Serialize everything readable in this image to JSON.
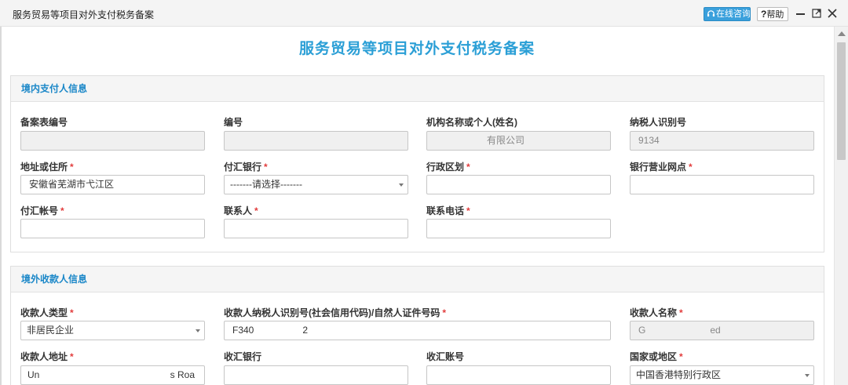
{
  "window": {
    "title": "服务贸易等项目对外支付税务备案",
    "consult_label": "在线咨询",
    "help_label": "帮助"
  },
  "page": {
    "title": "服务贸易等项目对外支付税务备案"
  },
  "colors": {
    "accent": "#2b9fd6",
    "section_header": "#1a87c8",
    "required": "#e23c3c",
    "consult_button": "#3aa0dc"
  },
  "domestic": {
    "section_title": "境内支付人信息",
    "record_no": {
      "label": "备案表编号",
      "value": ""
    },
    "number": {
      "label": "编号",
      "value": ""
    },
    "org_name": {
      "label": "机构名称或个人(姓名)",
      "value": "有限公司"
    },
    "taxpayer_id": {
      "label": "纳税人识别号",
      "value": "9134"
    },
    "address": {
      "label": "地址或住所",
      "value": "安徽省芜湖市弋江区"
    },
    "bank": {
      "label": "付汇银行",
      "value": "-------请选择-------"
    },
    "district": {
      "label": "行政区划",
      "value": ""
    },
    "branch": {
      "label": "银行营业网点",
      "value": ""
    },
    "account": {
      "label": "付汇帐号",
      "value": ""
    },
    "contact": {
      "label": "联系人",
      "value": ""
    },
    "phone": {
      "label": "联系电话",
      "value": ""
    },
    "required_mark": "*"
  },
  "overseas": {
    "section_title": "境外收款人信息",
    "payee_type": {
      "label": "收款人类型",
      "value": "非居民企业"
    },
    "payee_tax_id": {
      "label": "收款人纳税人识别号(社会信用代码)/自然人证件号码",
      "value": "F340",
      "value_tail": "2"
    },
    "payee_name": {
      "label": "收款人名称",
      "value": "G",
      "value_tail": "ed"
    },
    "payee_address": {
      "label": "收款人地址",
      "value": "Un",
      "value_tail": "s Roa"
    },
    "receiving_bank": {
      "label": "收汇银行",
      "value": ""
    },
    "receiving_account": {
      "label": "收汇账号",
      "value": ""
    },
    "country": {
      "label": "国家或地区",
      "value": "中国香港特别行政区"
    }
  }
}
